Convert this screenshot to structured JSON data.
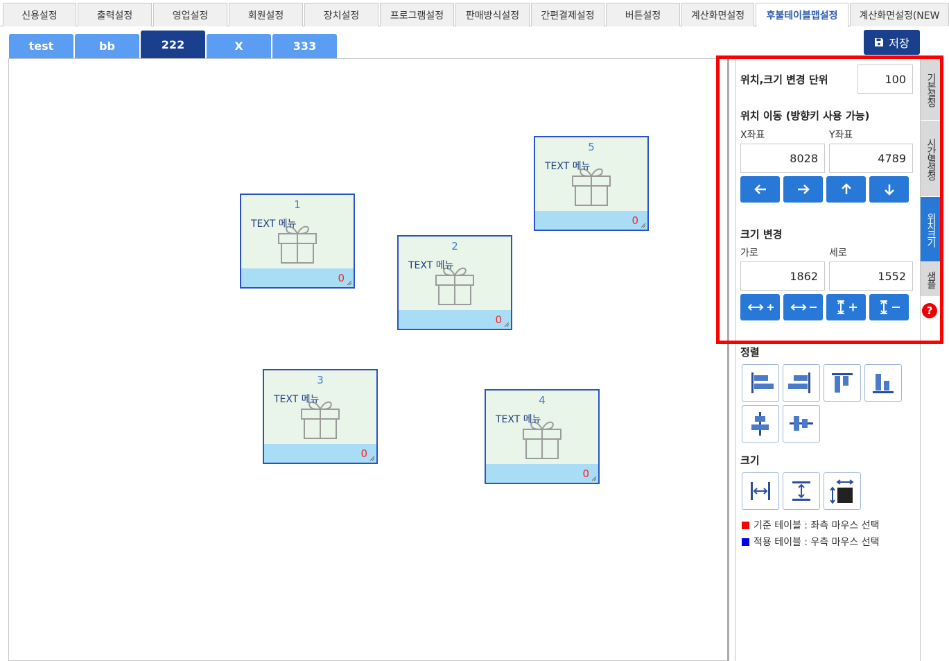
{
  "top_tabs": [
    "신용설정",
    "출력설정",
    "영업설정",
    "회원설정",
    "장치설정",
    "프로그램설정",
    "판매방식설정",
    "간편결제설정",
    "버튼설정",
    "계산화면설정",
    "후불테이블맵설정",
    "계산화면설정(NEW"
  ],
  "layout_tabs": [
    "test",
    "bb",
    "222",
    "X",
    "333"
  ],
  "active_layout_tab": "222",
  "save_label": "저장",
  "tables": [
    {
      "num": "1",
      "text": "TEXT 메뉴",
      "count": "0"
    },
    {
      "num": "2",
      "text": "TEXT 메뉴",
      "count": "0"
    },
    {
      "num": "3",
      "text": "TEXT 메뉴",
      "count": "0"
    },
    {
      "num": "4",
      "text": "TEXT 메뉴",
      "count": "0"
    },
    {
      "num": "5",
      "text": "TEXT 메뉴",
      "count": "0"
    }
  ],
  "panel": {
    "unit_label": "위치,크기 변경 단위",
    "unit_value": "100",
    "move_label": "위치 이동 (방향키 사용 가능)",
    "x_label": "X좌표",
    "y_label": "Y좌표",
    "x_value": "8028",
    "y_value": "4789",
    "size_label": "크기 변경",
    "w_label": "가로",
    "h_label": "세로",
    "w_value": "1862",
    "h_value": "1552",
    "align_label": "정렬",
    "sizing_label": "크기",
    "legend_ref": "기준 테이블 : 좌측 마우스 선택",
    "legend_apply": "적용 테이블 : 우측 마우스 선택"
  },
  "side_tabs": [
    "기본설정",
    "시간별설정",
    "위치크기",
    "샘플"
  ],
  "active_side_tab": "위치크기",
  "colors": {
    "primary": "#1a3f8c",
    "accent": "#2878d8",
    "highlight": "#ff0000"
  }
}
